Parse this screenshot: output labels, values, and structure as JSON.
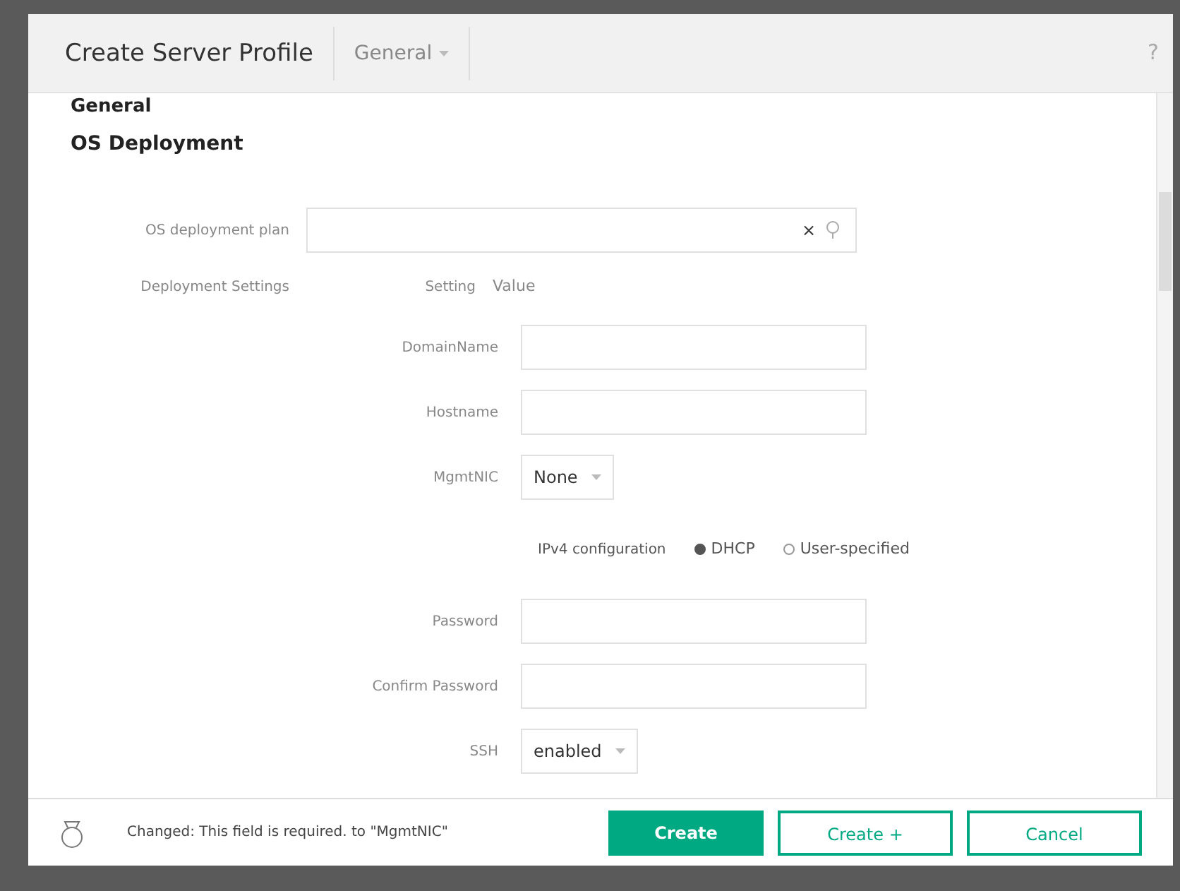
{
  "dialog": {
    "title": "Create Server Profile",
    "section_menu": "General",
    "help": "?"
  },
  "sections": [
    {
      "title": "General",
      "kind": "cut"
    },
    {
      "title": "OS Deployment",
      "kind": "full"
    }
  ],
  "plan": {
    "label": "OS deployment plan",
    "clear": "×"
  },
  "settings": {
    "label": "Deployment Settings",
    "setting_header": "Setting",
    "value_header": "Value"
  },
  "rows": [
    {
      "kind": "text",
      "label": "DomainName"
    },
    {
      "kind": "text",
      "label": "Hostname"
    },
    {
      "kind": "select",
      "label": "MgmtNIC",
      "value": "None"
    },
    {
      "kind": "radio",
      "label": "IPv4 configuration",
      "options": [
        {
          "label": "DHCP",
          "selected": true
        },
        {
          "label": "User-specified",
          "selected": false
        }
      ]
    },
    {
      "kind": "text",
      "label": "Password"
    },
    {
      "kind": "text",
      "label": "Confirm Password"
    },
    {
      "kind": "select",
      "label": "SSH",
      "value": "enabled"
    }
  ],
  "footer": {
    "message": "Changed: This field is required. to \"MgmtNIC\"",
    "buttons": [
      {
        "label": "Create",
        "kind": "primary"
      },
      {
        "label": "Create +",
        "kind": "outline"
      },
      {
        "label": "Cancel",
        "kind": "outline"
      }
    ]
  }
}
